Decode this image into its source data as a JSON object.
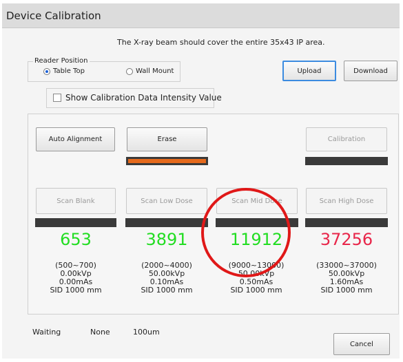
{
  "window": {
    "title": "Device Calibration"
  },
  "instruction": "The X-ray beam should cover the entire  35x43 IP area.",
  "reader_position": {
    "label": "Reader Position",
    "options": [
      {
        "label": "Table Top",
        "selected": true
      },
      {
        "label": "Wall Mount",
        "selected": false
      }
    ]
  },
  "top_buttons": {
    "upload": "Upload",
    "download": "Download"
  },
  "show_intensity": {
    "label": "Show Calibration Data Intensity Value",
    "checked": false
  },
  "action_buttons": {
    "auto_alignment": "Auto Alignment",
    "erase": "Erase",
    "calibration": "Calibration"
  },
  "scans": [
    {
      "label": "Scan Blank",
      "count": "653",
      "count_color": "#22dd22",
      "range": "(500~700)",
      "kvp": "0.00kVp",
      "mas": "0.00mAs",
      "sid": "SID 1000 mm"
    },
    {
      "label": "Scan Low Dose",
      "count": "3891",
      "count_color": "#22dd22",
      "range": "(2000~4000)",
      "kvp": "50.00kVp",
      "mas": "0.10mAs",
      "sid": "SID 1000 mm"
    },
    {
      "label": "Scan Mid Dose",
      "count": "11912",
      "count_color": "#22dd22",
      "range": "(9000~13000)",
      "kvp": "50.00kVp",
      "mas": "0.50mAs",
      "sid": "SID 1000 mm"
    },
    {
      "label": "Scan High Dose",
      "count": "37256",
      "count_color": "#e8264a",
      "range": "(33000~37000)",
      "kvp": "50.00kVp",
      "mas": "1.60mAs",
      "sid": "SID 1000 mm"
    }
  ],
  "status_bar": {
    "state": "Waiting",
    "mode": "None",
    "resolution": "100um"
  },
  "cancel_button": "Cancel",
  "annotation_color": "#e01818"
}
